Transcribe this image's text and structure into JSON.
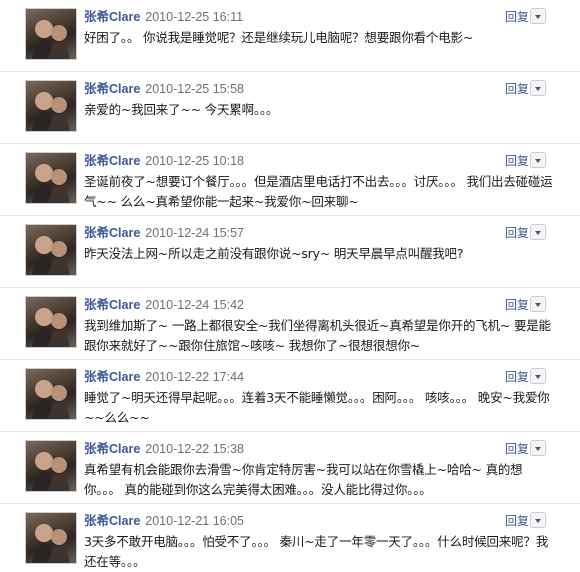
{
  "posts": [
    {
      "author": "张希Clare",
      "timestamp": "2010-12-25 16:11",
      "reply_label": "回复",
      "message": "好困了。。 你说我是睡觉呢？还是继续玩儿电脑呢？想要跟你看个电影~"
    },
    {
      "author": "张希Clare",
      "timestamp": "2010-12-25 15:58",
      "reply_label": "回复",
      "message": "亲爱的~我回来了~~ 今天累啊。。。"
    },
    {
      "author": "张希Clare",
      "timestamp": "2010-12-25 10:18",
      "reply_label": "回复",
      "message": "圣诞前夜了~想要订个餐厅。。。但是酒店里电话打不出去。。。讨厌。。。 我们出去碰碰运气~~ 么么~真希望你能一起来~我爱你~回来聊~"
    },
    {
      "author": "张希Clare",
      "timestamp": "2010-12-24 15:57",
      "reply_label": "回复",
      "message": "昨天没法上网~所以走之前没有跟你说~sry~ 明天早晨早点叫醒我吧?"
    },
    {
      "author": "张希Clare",
      "timestamp": "2010-12-24 15:42",
      "reply_label": "回复",
      "message": "我到维加斯了~ 一路上都很安全~我们坐得离机头很近~真希望是你开的飞机~ 要是能跟你来就好了~~跟你住旅馆~咳咳~ 我想你了~很想很想你~"
    },
    {
      "author": "张希Clare",
      "timestamp": "2010-12-22 17:44",
      "reply_label": "回复",
      "message": "睡觉了~明天还得早起呢。。。连着3天不能睡懒觉。。。困阿。。。 咳咳。。。 晚安~我爱你~~么么~~"
    },
    {
      "author": "张希Clare",
      "timestamp": "2010-12-22 15:38",
      "reply_label": "回复",
      "message": "真希望有机会能跟你去滑雪~你肯定特厉害~我可以站在你雪橇上~哈哈~ 真的想你。。。 真的能碰到你这么完美得太困难。。。没人能比得过你。。。"
    },
    {
      "author": "张希Clare",
      "timestamp": "2010-12-21 16:05",
      "reply_label": "回复",
      "message": "3天多不敢开电脑。。。怕受不了。。。 秦川~走了一年零一天了。。。什么时候回来呢？我还在等。。。"
    }
  ]
}
